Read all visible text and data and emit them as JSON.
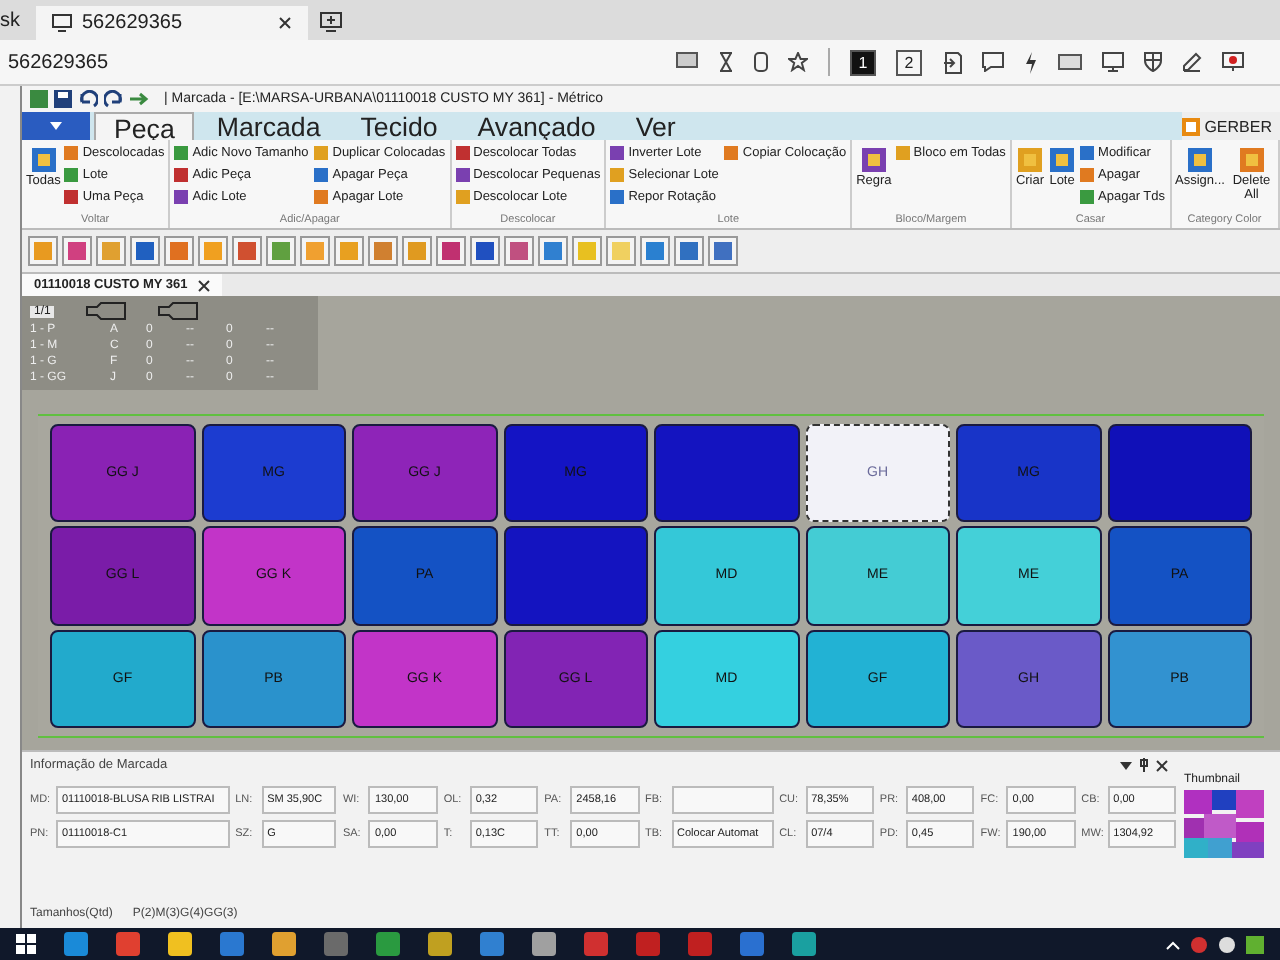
{
  "remote": {
    "cut_tab": "sk",
    "tab": "562629365",
    "address": "562629365",
    "screen_buttons": [
      {
        "label": "1",
        "selected": true
      },
      {
        "label": "2",
        "selected": false
      }
    ]
  },
  "app": {
    "title": "| Marcada - [E:\\MARSA-URBANA\\01110018  CUSTO MY 361] - Métrico",
    "brand": "GERBER"
  },
  "ribbon_tabs": [
    {
      "label": "Peça",
      "selected": true
    },
    {
      "label": "Marcada",
      "selected": false
    },
    {
      "label": "Tecido",
      "selected": false
    },
    {
      "label": "Avançado",
      "selected": false
    },
    {
      "label": "Ver",
      "selected": false
    }
  ],
  "ribbon_groups": [
    {
      "title": "Voltar",
      "large": [
        "Todas"
      ],
      "small": [
        "Descolocadas",
        "Lote",
        "Uma Peça"
      ]
    },
    {
      "title": "Adic/Apagar",
      "small": [
        "Adic Novo Tamanho",
        "Adic Peça",
        "Adic Lote",
        "Duplicar Colocadas",
        "Apagar Peça",
        "Apagar Lote"
      ]
    },
    {
      "title": "Descolocar",
      "small": [
        "Descolocar Todas",
        "Descolocar Pequenas",
        "Descolocar Lote"
      ]
    },
    {
      "title": "Lote",
      "small": [
        "Inverter Lote",
        "Selecionar Lote",
        "Repor Rotação",
        "Copiar Colocação"
      ]
    },
    {
      "title": "Bloco/Margem",
      "large": [
        "Regra"
      ],
      "small": [
        "Bloco em Todas"
      ]
    },
    {
      "title": "Casar",
      "large": [
        "Criar",
        "Lote"
      ],
      "small": [
        "Modificar",
        "Apagar",
        "Apagar Tds"
      ]
    },
    {
      "title": "Category Color",
      "large": [
        "Assign...",
        "Delete All"
      ]
    }
  ],
  "document_tab": "01110018  CUSTO MY 361",
  "size_table": {
    "header": "1/1",
    "rows": [
      {
        "size": "1 - P",
        "code": "A",
        "cells": [
          "0",
          "--",
          "0",
          "--"
        ]
      },
      {
        "size": "1 - M",
        "code": "C",
        "cells": [
          "0",
          "--",
          "0",
          "--"
        ]
      },
      {
        "size": "1 - G",
        "code": "F",
        "cells": [
          "0",
          "--",
          "0",
          "--"
        ]
      },
      {
        "size": "1 - GG",
        "code": "J",
        "cells": [
          "0",
          "--",
          "0",
          "--"
        ]
      }
    ]
  },
  "marker_rows": [
    [
      {
        "label": "GG J",
        "color": "#8a22b4",
        "selected": false
      },
      {
        "label": "MG",
        "color": "#1c3cd0",
        "selected": false
      },
      {
        "label": "GG J",
        "color": "#8e24b8",
        "selected": false
      },
      {
        "label": "MG",
        "color": "#1414c4",
        "selected": false
      },
      {
        "color": "#1414c0",
        "selected": false
      },
      {
        "label": "GH",
        "color": "#f2f2f8",
        "selected": true
      },
      {
        "label": "MG",
        "color": "#1834c8",
        "selected": false
      },
      {
        "color": "#1010b8",
        "selected": false
      }
    ],
    [
      {
        "label": "GG L",
        "color": "#7a1ca8",
        "selected": false
      },
      {
        "label": "GG K",
        "color": "#c234c8",
        "selected": false
      },
      {
        "label": "PA",
        "color": "#1452c4",
        "selected": false
      },
      {
        "color": "#1414c0",
        "selected": false
      },
      {
        "label": "MD",
        "color": "#34c8d8",
        "selected": false
      },
      {
        "label": "ME",
        "color": "#44ccd4",
        "selected": false
      },
      {
        "label": "ME",
        "color": "#44d0d8",
        "selected": false
      },
      {
        "label": "PA",
        "color": "#1452c4",
        "selected": false
      }
    ],
    [
      {
        "label": "GF",
        "color": "#22aacc",
        "selected": false
      },
      {
        "label": "PB",
        "color": "#2a92cc",
        "selected": false
      },
      {
        "label": "GG K",
        "color": "#c234c8",
        "selected": false
      },
      {
        "label": "GG L",
        "color": "#8224b4",
        "selected": false
      },
      {
        "label": "MD",
        "color": "#34d0e0",
        "selected": false
      },
      {
        "label": "GF",
        "color": "#22b2d4",
        "selected": false
      },
      {
        "label": "GH",
        "color": "#6a5ac8",
        "selected": false
      },
      {
        "label": "PB",
        "color": "#3292d0",
        "selected": false
      }
    ]
  ],
  "marker_info": {
    "title": "Informação de Marcada",
    "fields": [
      {
        "label": "MD:",
        "value": "01110018-BLUSA RIB LISTRAI"
      },
      {
        "label": "PN:",
        "value": "01110018-C1"
      },
      {
        "label": "LN:",
        "value": "SM 35,90C"
      },
      {
        "label": "SZ:",
        "value": "G"
      },
      {
        "label": "WI:",
        "value": "130,00"
      },
      {
        "label": "SA:",
        "value": "0,00"
      },
      {
        "label": "OL:",
        "value": "0,32"
      },
      {
        "label": "T:",
        "value": "0,13C"
      },
      {
        "label": "PA:",
        "value": "2458,16"
      },
      {
        "label": "TT:",
        "value": "0,00"
      },
      {
        "label": "FB:"
      },
      {
        "label": "TB:",
        "value": "Colocar Automat"
      },
      {
        "label": "CU:",
        "value": "78,35%"
      },
      {
        "label": "CL:",
        "value": "07/4"
      },
      {
        "label": "PR:",
        "value": "408,00"
      },
      {
        "label": "PD:",
        "value": "0,45"
      },
      {
        "label": "FC:",
        "value": "0,00"
      },
      {
        "label": "FW:",
        "value": "190,00"
      },
      {
        "label": "CB:",
        "value": "0,00"
      },
      {
        "label": "MW:",
        "value": "1304,92"
      }
    ],
    "sizes_label": "Tamanhos(Qtd)",
    "sizes_value": "P(2)M(3)G(4)GG(3)"
  },
  "thumbnail": {
    "title": "Thumbnail"
  }
}
